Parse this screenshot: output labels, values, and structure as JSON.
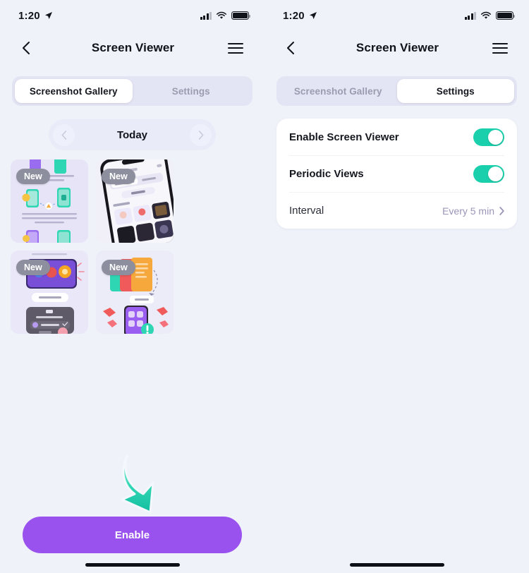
{
  "meta": {
    "accent_purple": "#9a52ef",
    "accent_teal": "#1ad0ac",
    "bg": "#eff2f9"
  },
  "status_bar": {
    "time": "1:20",
    "location_icon": "location-arrow-icon",
    "signal_icon": "cellular-signal-icon",
    "wifi_icon": "wifi-icon",
    "battery_icon": "battery-full-icon"
  },
  "nav": {
    "back_icon": "chevron-left-icon",
    "title": "Screen Viewer",
    "menu_icon": "hamburger-menu-icon"
  },
  "tabs": [
    {
      "label": "Screenshot Gallery"
    },
    {
      "label": "Settings"
    }
  ],
  "left_panel": {
    "active_tab_index": 0,
    "date_nav": {
      "prev_icon": "chevron-left-icon",
      "label": "Today",
      "next_icon": "chevron-right-icon"
    },
    "gallery": [
      {
        "badge": "New",
        "name": "screenshot-thumbnail-1"
      },
      {
        "badge": "New",
        "name": "screenshot-thumbnail-2"
      },
      {
        "badge": "New",
        "name": "screenshot-thumbnail-3"
      },
      {
        "badge": "New",
        "name": "screenshot-thumbnail-4"
      }
    ],
    "cta": {
      "label": "Enable",
      "hint_icon": "curved-down-arrow-icon"
    }
  },
  "right_panel": {
    "active_tab_index": 1,
    "settings": [
      {
        "label": "Enable Screen Viewer",
        "control": "toggle",
        "value": "on"
      },
      {
        "label": "Periodic Views",
        "control": "toggle",
        "value": "on"
      },
      {
        "label": "Interval",
        "control": "disclosure",
        "value": "Every 5 min",
        "chevron": "chevron-right-icon"
      }
    ]
  }
}
